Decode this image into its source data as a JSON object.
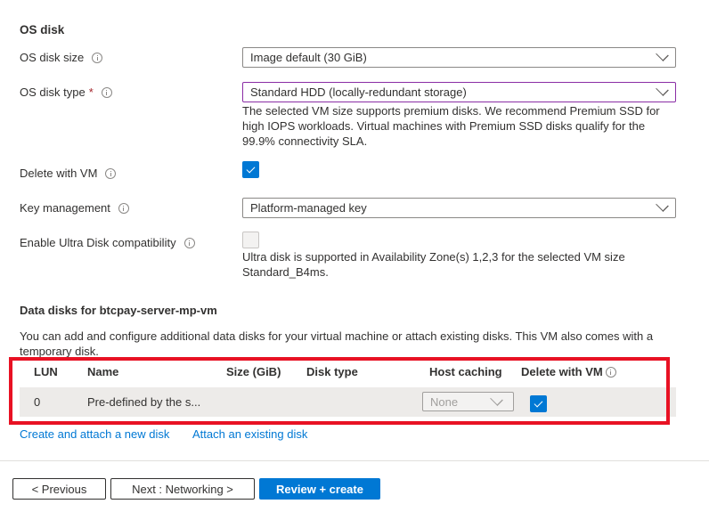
{
  "os_disk": {
    "section_title": "OS disk",
    "size": {
      "label": "OS disk size",
      "value": "Image default (30 GiB)"
    },
    "type": {
      "label": "OS disk type",
      "required_mark": "*",
      "value": "Standard HDD (locally-redundant storage)",
      "helper": "The selected VM size supports premium disks. We recommend Premium SSD for high IOPS workloads. Virtual machines with Premium SSD disks qualify for the 99.9% connectivity SLA."
    },
    "delete_with_vm": {
      "label": "Delete with VM",
      "checked": true
    },
    "key_management": {
      "label": "Key management",
      "value": "Platform-managed key"
    },
    "ultra_disk": {
      "label": "Enable Ultra Disk compatibility",
      "checked": false,
      "helper": "Ultra disk is supported in Availability Zone(s) 1,2,3 for the selected VM size Standard_B4ms."
    }
  },
  "data_disks": {
    "title": "Data disks for btcpay-server-mp-vm",
    "description": "You can add and configure additional data disks for your virtual machine or attach existing disks. This VM also comes with a temporary disk.",
    "columns": [
      "LUN",
      "Name",
      "Size (GiB)",
      "Disk type",
      "Host caching",
      "Delete with VM"
    ],
    "rows": [
      {
        "lun": "0",
        "name": "Pre-defined by the s...",
        "size": "",
        "disk_type": "",
        "host_caching": "None",
        "delete_with_vm": true
      }
    ],
    "links": {
      "create": "Create and attach a new disk",
      "attach": "Attach an existing disk"
    },
    "highlight_color": "#e81123"
  },
  "footer": {
    "previous": "< Previous",
    "next": "Next : Networking >",
    "review": "Review + create"
  },
  "colors": {
    "accent": "#0078d4",
    "focus_border": "#8a2da5",
    "required": "#a4262c"
  }
}
